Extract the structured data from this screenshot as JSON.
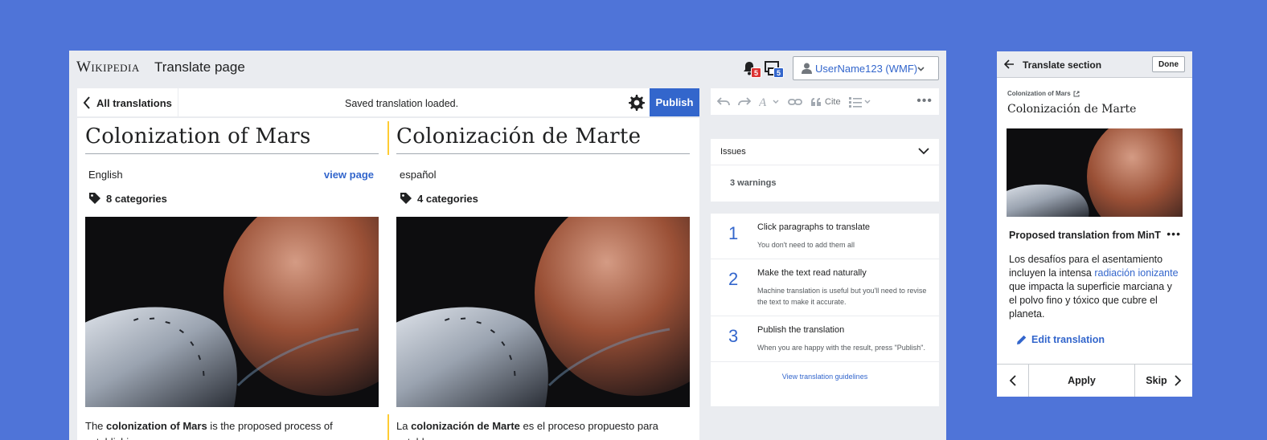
{
  "header": {
    "logo": "Wikipedia",
    "page_title": "Translate page",
    "notifications_alert_count": "5",
    "notifications_notice_count": "5",
    "username": "UserName123 (WMF)"
  },
  "toolbar": {
    "back_label": "All translations",
    "status": "Saved translation loaded.",
    "publish_label": "Publish"
  },
  "source": {
    "title": "Colonization of Mars",
    "language": "English",
    "view_page": "view page",
    "categories": "8 categories",
    "para_prefix": "The ",
    "para_bold": "colonization of Mars",
    "para_rest": " is the proposed process of establishing"
  },
  "target": {
    "title": "Colonización de Marte",
    "language": "español",
    "categories": "4 categories",
    "para_prefix": "La ",
    "para_bold": "colonización de Marte",
    "para_rest": " es el proceso propuesto para establecer"
  },
  "tools": {
    "cite_label": "Cite"
  },
  "issues": {
    "label": "Issues",
    "warnings": "3 warnings"
  },
  "steps": [
    {
      "num": "1",
      "title": "Click paragraphs to translate",
      "desc": "You don't need to add them all"
    },
    {
      "num": "2",
      "title": "Make the text read naturally",
      "desc": "Machine translation is useful but you'll need to revise the text to make it accurate."
    },
    {
      "num": "3",
      "title": "Publish the translation",
      "desc": "When you are happy with the result, press \"Publish\"."
    }
  ],
  "guidelines_link": "View translation guidelines",
  "mobile": {
    "header_title": "Translate section",
    "done_label": "Done",
    "source_title": "Colonization of Mars",
    "article_title": "Colonización de Marte",
    "proposed_title": "Proposed translation from MinT",
    "text_before": "Los desafíos para el asentamiento incluyen la intensa ",
    "text_link": "radiación ionizante",
    "text_after": " que impacta la superficie marciana y el polvo fino y tóxico que cubre el planeta.",
    "edit_label": "Edit translation",
    "apply_label": "Apply",
    "skip_label": "Skip"
  },
  "colors": {
    "background": "#4f74d8",
    "accent": "#3366cc",
    "highlight": "#ffcc33",
    "alert_badge": "#dd3333"
  }
}
